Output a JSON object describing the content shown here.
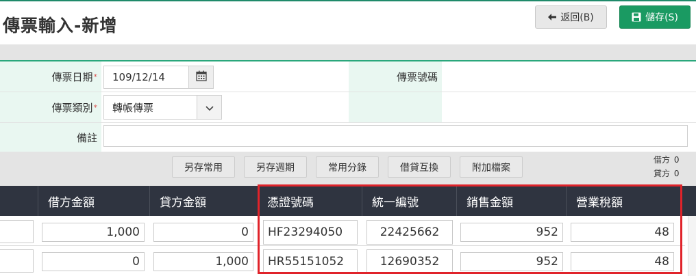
{
  "page": {
    "title": "傳票輸入-新增"
  },
  "toolbar": {
    "back_label": "返回(B)",
    "save_label": "儲存(S)"
  },
  "form": {
    "date_label": "傳票日期",
    "date_required": "*",
    "date_value": "109/12/14",
    "type_label": "傳票類別",
    "type_required": "*",
    "type_value": "轉帳傳票",
    "voucher_no_label": "傳票號碼",
    "remark_label": "備註",
    "remark_value": ""
  },
  "actions": {
    "save_common": "另存常用",
    "save_periodic": "另存週期",
    "common_entries": "常用分錄",
    "swap_dc": "借貸互換",
    "attach": "附加檔案"
  },
  "balance": {
    "debit_label": "借方",
    "debit_value": "0",
    "credit_label": "貸方",
    "credit_value": "0"
  },
  "table": {
    "headers": [
      "借方金額",
      "貸方金額",
      "憑證號碼",
      "統一編號",
      "銷售金額",
      "營業稅額"
    ],
    "rows": [
      {
        "debit": "1,000",
        "credit": "0",
        "voucher": "HF23294050",
        "tax_id": "22425662",
        "sales": "952",
        "tax": "48"
      },
      {
        "debit": "0",
        "credit": "1,000",
        "voucher": "HR55151052",
        "tax_id": "12690352",
        "sales": "952",
        "tax": "48"
      }
    ]
  },
  "colors": {
    "accent": "#1a9a62",
    "header_bg": "#2f3440",
    "label_bg": "#e9f7f1",
    "highlight": "#e0232a"
  },
  "icons": {
    "back": "arrow-left-icon",
    "save": "floppy-disk-icon",
    "calendar": "calendar-icon",
    "dropdown": "chevron-down-icon"
  }
}
